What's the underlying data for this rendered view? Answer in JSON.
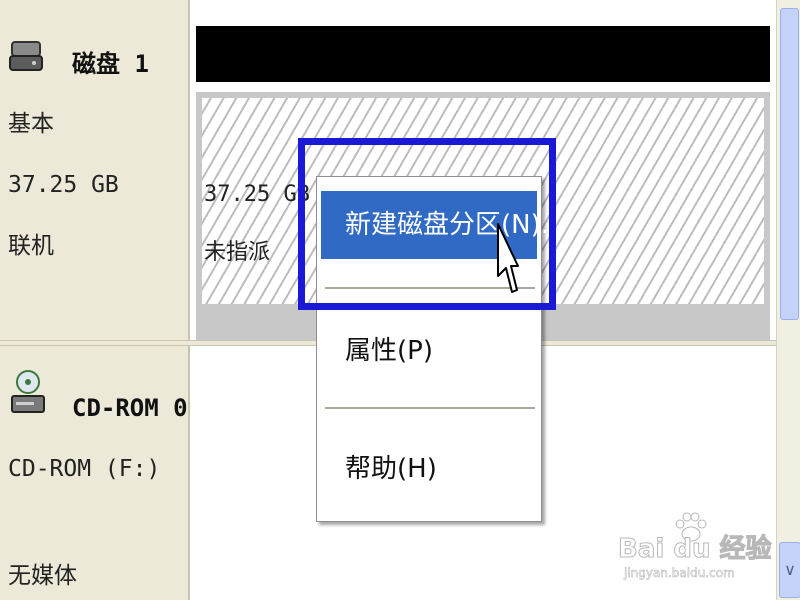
{
  "disk1": {
    "name": "磁盘 1",
    "type": "基本",
    "size": "37.25 GB",
    "status": "联机"
  },
  "volume": {
    "size": "37.25 GB",
    "state": "未指派"
  },
  "cdrom": {
    "name": "CD-ROM 0",
    "label": "CD-ROM (F:)",
    "media": "无媒体"
  },
  "context_menu": {
    "items": [
      {
        "label": "新建磁盘分区(N)..."
      },
      {
        "label": "属性(P)"
      },
      {
        "label": "帮助(H)"
      }
    ]
  },
  "watermark": {
    "brand": "Bai du 经验",
    "sub": "jingyan.baidu.com"
  },
  "colors": {
    "menu_selection": "#316ac5",
    "highlight_box": "#1a1ad6",
    "panel_bg": "#ece9d8"
  }
}
